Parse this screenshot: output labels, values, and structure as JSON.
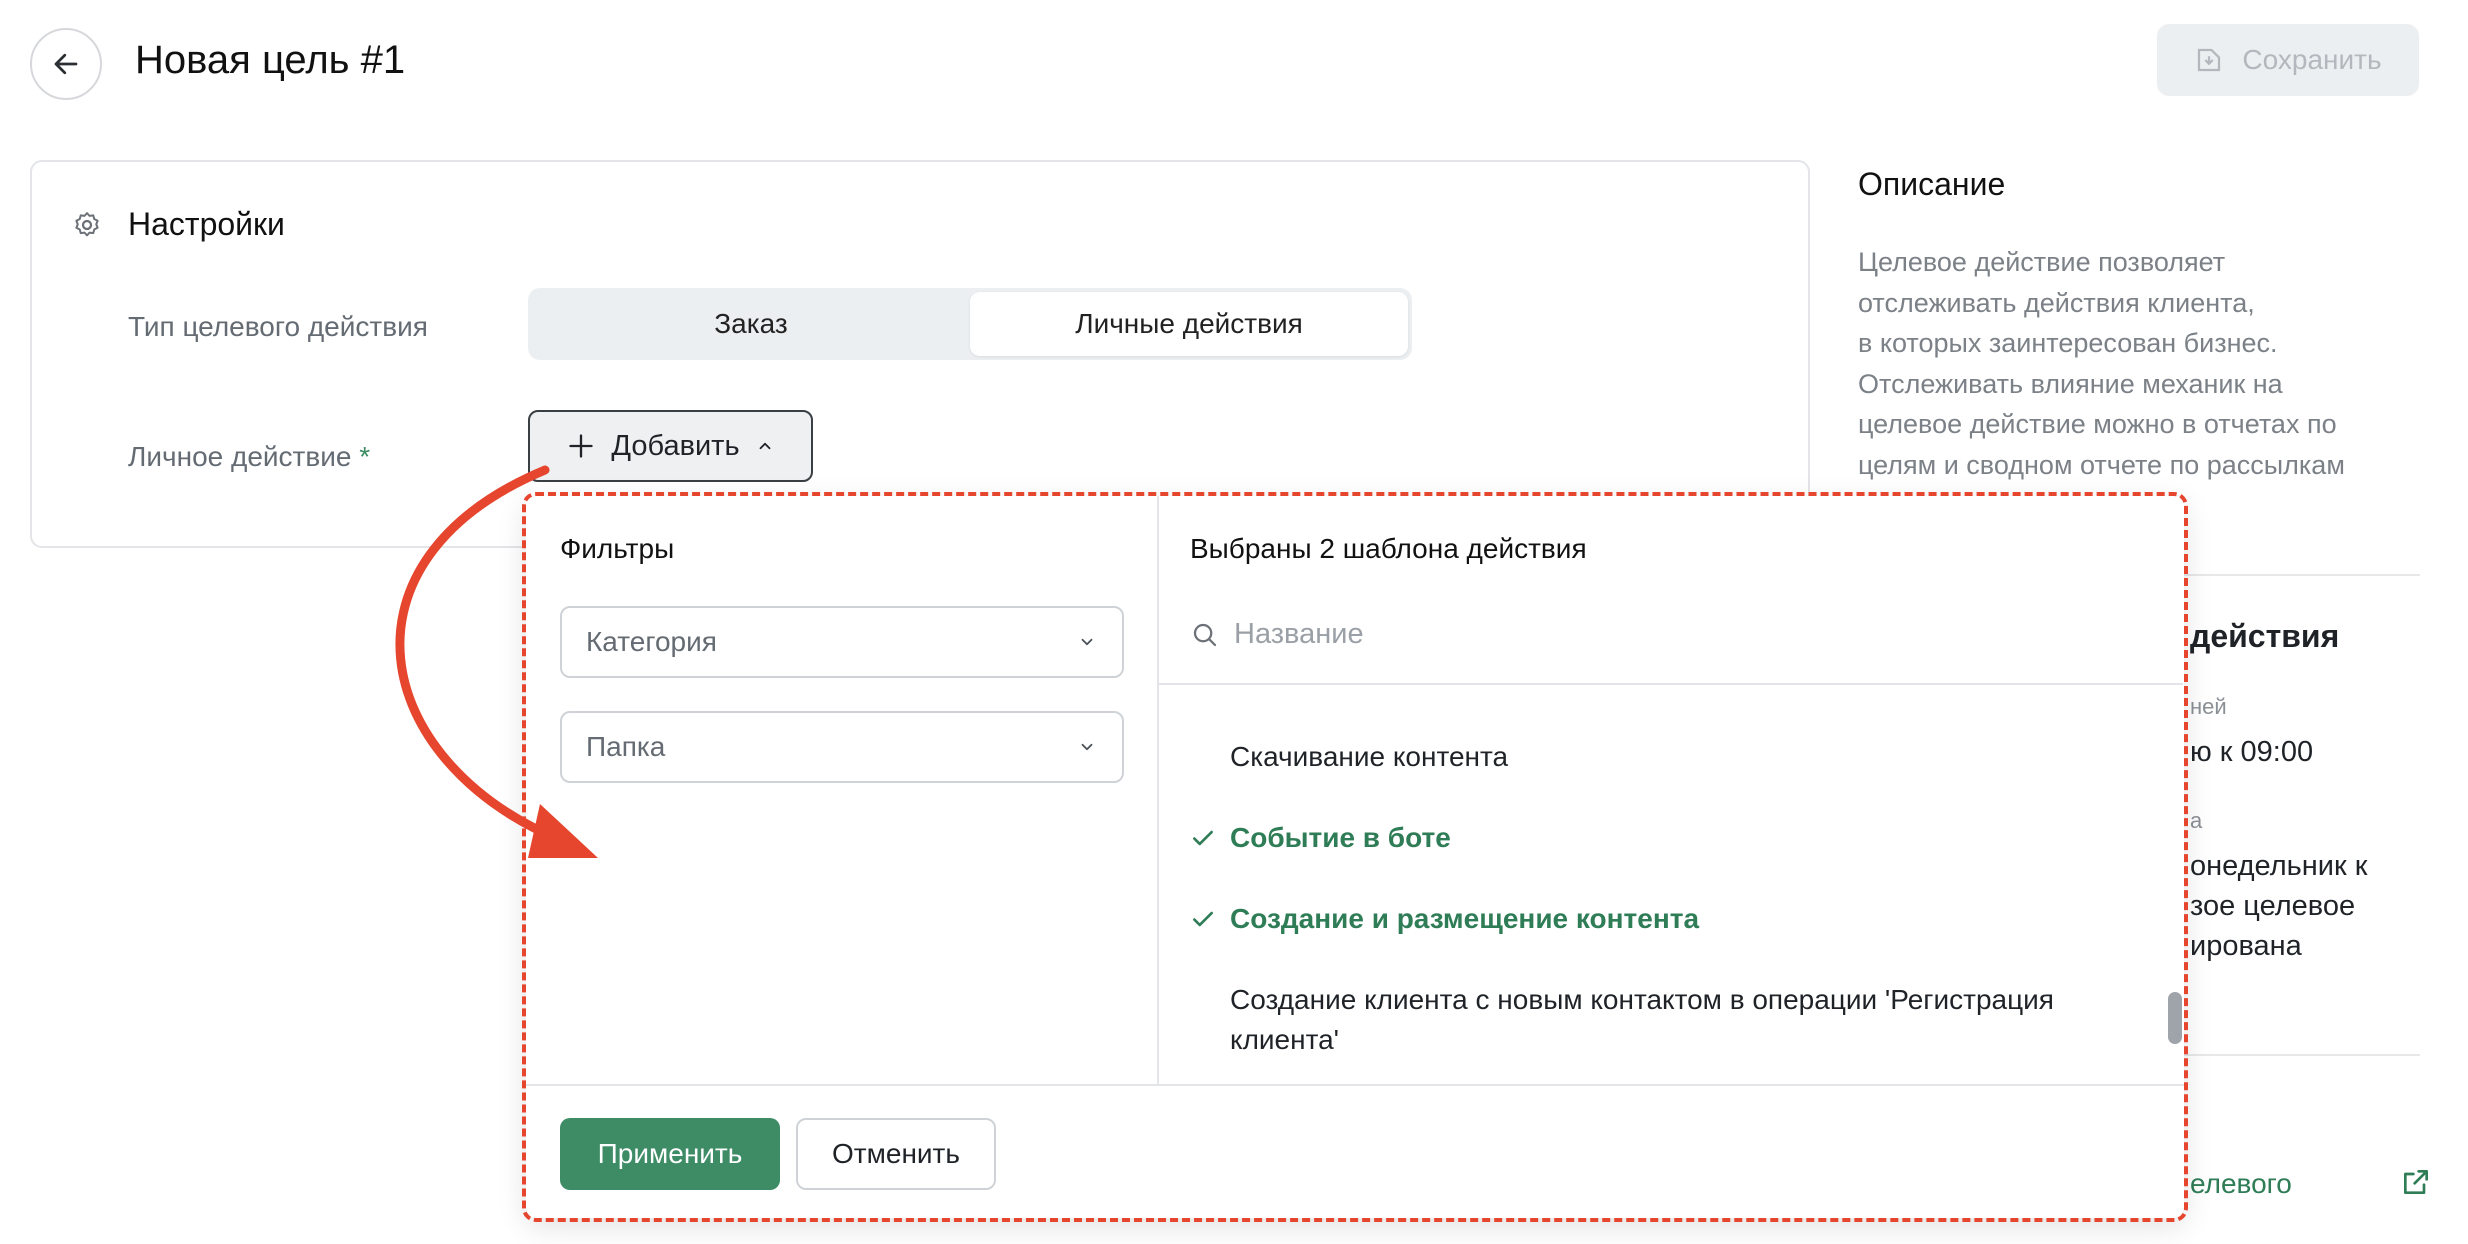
{
  "header": {
    "title": "Новая цель #1",
    "save_label": "Сохранить"
  },
  "settings": {
    "title": "Настройки",
    "type_label": "Тип целевого действия",
    "segments": [
      {
        "label": "Заказ",
        "active": false
      },
      {
        "label": "Личные действия",
        "active": true
      }
    ],
    "personal_action_label": "Личное действие",
    "required_mark": "*",
    "add_label": "Добавить"
  },
  "description": {
    "title": "Описание",
    "lines": [
      "Целевое действие позволяет",
      "отслеживать действия клиента,",
      "в которых заинтересован бизнес.",
      "Отслеживать влияние механик на",
      "целевое действие можно в отчетах по",
      "целям и сводном отчете по рассылкам"
    ],
    "partial_heading": "действия",
    "partial_small_1": "ней",
    "partial_value_1": "ю к 09:00",
    "partial_small_2": "а",
    "partial_lines": [
      "онедельник к",
      "зое целевое",
      "ирована"
    ],
    "partial_link": "елевого"
  },
  "dropdown": {
    "filters_title": "Фильтры",
    "category_placeholder": "Категория",
    "folder_placeholder": "Папка",
    "selected_title": "Выбраны 2 шаблона действия",
    "search_placeholder": "Название",
    "items": [
      {
        "label": "Скачивание контента",
        "selected": false
      },
      {
        "label": "Событие в боте",
        "selected": true
      },
      {
        "label": "Создание и размещение контента",
        "selected": true
      },
      {
        "label": "Создание клиента с новым контактом в операции 'Регистрация клиента'",
        "selected": false
      }
    ],
    "apply_label": "Применить",
    "cancel_label": "Отменить"
  },
  "colors": {
    "accent": "#3d8c66",
    "selected_text": "#2f7d57",
    "annotation": "#e6452e"
  },
  "icons": [
    "arrow-left-icon",
    "save-icon",
    "gear-icon",
    "plus-icon",
    "chevron-up-icon",
    "chevron-down-icon",
    "search-icon",
    "check-icon",
    "external-link-icon"
  ]
}
